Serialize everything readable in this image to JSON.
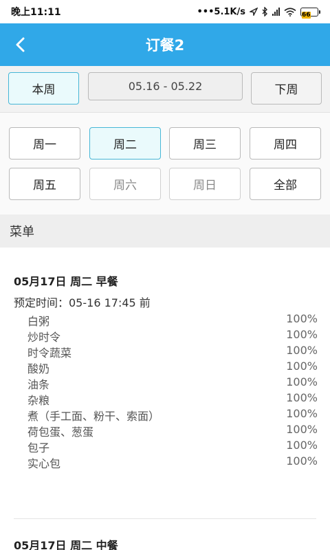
{
  "status_bar": {
    "time": "晚上11:11",
    "speed": "•••5.1K/s",
    "battery": "66"
  },
  "header": {
    "title": "订餐2"
  },
  "week_nav": {
    "this_week": "本周",
    "date_range": "05.16 - 05.22",
    "next_week": "下周"
  },
  "days": [
    {
      "label": "周一"
    },
    {
      "label": "周二"
    },
    {
      "label": "周三"
    },
    {
      "label": "周四"
    },
    {
      "label": "周五"
    },
    {
      "label": "周六"
    },
    {
      "label": "周日"
    },
    {
      "label": "全部"
    }
  ],
  "menu_header": "菜单",
  "meals": [
    {
      "title": "05月17日 周二 早餐",
      "deadline": "预定时间：05-16 17:45 前",
      "dishes": [
        {
          "name": "白粥",
          "pct": "100%"
        },
        {
          "name": "炒时令",
          "pct": "100%"
        },
        {
          "name": "时令蔬菜",
          "pct": "100%"
        },
        {
          "name": "酸奶",
          "pct": "100%"
        },
        {
          "name": "油条",
          "pct": "100%"
        },
        {
          "name": "杂粮",
          "pct": "100%"
        },
        {
          "name": "煮（手工面、粉干、索面）",
          "pct": "100%"
        },
        {
          "name": "荷包蛋、葱蛋",
          "pct": "100%"
        },
        {
          "name": "包子",
          "pct": "100%"
        },
        {
          "name": "实心包",
          "pct": "100%"
        }
      ]
    },
    {
      "title": "05月17日 周二 中餐"
    }
  ]
}
